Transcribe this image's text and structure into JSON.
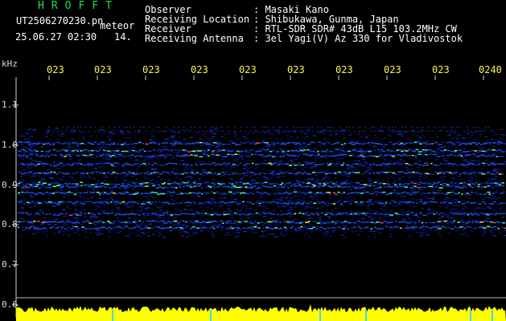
{
  "app": {
    "title": "HROFFT",
    "file_name": "UT2506270230.pn",
    "mode_label": "meteor",
    "date_time": "25.06.27 02:30",
    "count": "14."
  },
  "info": {
    "observer_label": "Observer",
    "observer_value": ": Masaki Kano",
    "location_label": "Receiving Location",
    "location_value": ": Shibukawa, Gunma, Japan",
    "receiver_label": "Receiver",
    "receiver_value": ": RTL-SDR SDR# 43dB L15 103.2MHz CW",
    "antenna_label": "Receiving Antenna",
    "antenna_value": ": 3el Yagi(V) Az 330 for Vladivostok"
  },
  "axis": {
    "unit": "kHz",
    "y_ticks": [
      "1.1",
      "1.0",
      "0.9",
      "0.8",
      "0.7",
      "0.6"
    ],
    "x_ticks": [
      "023",
      "023",
      "023",
      "023",
      "023",
      "023",
      "023",
      "023",
      "023",
      "0240"
    ]
  },
  "colors": {
    "background": "#000000",
    "header_green": "#22e04a",
    "time_yellow": "#ffef5a",
    "signal_yellow": "#ffff00"
  }
}
